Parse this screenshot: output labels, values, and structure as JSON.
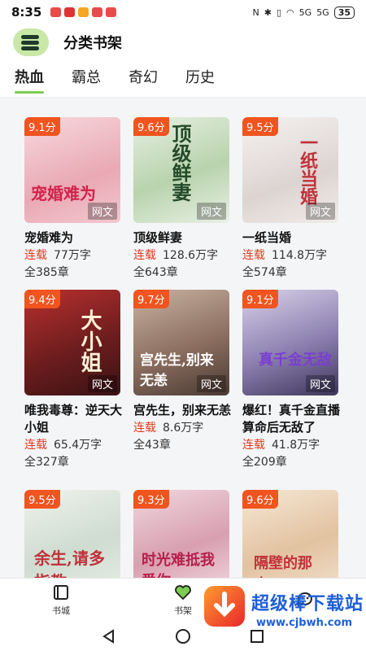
{
  "status": {
    "time": "8:35",
    "battery": "35",
    "signal": "5G"
  },
  "header": {
    "title": "分类书架",
    "logo_icon": "bookshelf-icon"
  },
  "tabs": [
    "热血",
    "霸总",
    "奇幻",
    "历史"
  ],
  "colors": {
    "accent": "#7ccd52",
    "score_badge": "#f0541f",
    "serial_status": "#e23b1c"
  },
  "books": [
    {
      "score": "9.1分",
      "title": "宠婚难为",
      "status": "连载",
      "words": "77万字",
      "chapters": "全385章",
      "cover_text": "宠婚难为",
      "tag": "网文"
    },
    {
      "score": "9.6分",
      "title": "顶级鲜妻",
      "status": "连载",
      "words": "128.6万字",
      "chapters": "全643章",
      "cover_text": "顶级鲜妻",
      "tag": "网文"
    },
    {
      "score": "9.5分",
      "title": "一纸当婚",
      "status": "连载",
      "words": "114.8万字",
      "chapters": "全574章",
      "cover_text": "一纸当婚",
      "tag": "网文"
    },
    {
      "score": "9.4分",
      "title": "唯我毒尊：逆天大小姐",
      "status": "连载",
      "words": "65.4万字",
      "chapters": "全327章",
      "cover_text": "大小姐",
      "tag": "网文"
    },
    {
      "score": "9.7分",
      "title": "宫先生，别来无恙",
      "status": "连载",
      "words": "8.6万字",
      "chapters": "全43章",
      "cover_text": "宫先生,别来无恙",
      "tag": "网文"
    },
    {
      "score": "9.1分",
      "title": "爆红！真千金直播算命后无敌了",
      "status": "连载",
      "words": "41.8万字",
      "chapters": "全209章",
      "cover_text": "真千金无敌",
      "tag": "网文"
    },
    {
      "score": "9.5分",
      "title": "",
      "status": "",
      "words": "",
      "chapters": "",
      "cover_text": "余生,请多指教",
      "tag": ""
    },
    {
      "score": "9.3分",
      "title": "",
      "status": "",
      "words": "",
      "chapters": "",
      "cover_text": "时光难抵我爱你",
      "tag": ""
    },
    {
      "score": "9.6分",
      "title": "",
      "status": "",
      "words": "",
      "chapters": "",
      "cover_text": "隔壁的那个... ",
      "tag": ""
    }
  ],
  "nav": [
    {
      "label": "书城",
      "icon": "book-city-icon"
    },
    {
      "label": "书架",
      "icon": "heart-icon"
    },
    {
      "label": "",
      "icon": "chat-icon"
    }
  ],
  "watermark": {
    "name": "超级棒下载站",
    "url": "www.cjbwh.com"
  }
}
